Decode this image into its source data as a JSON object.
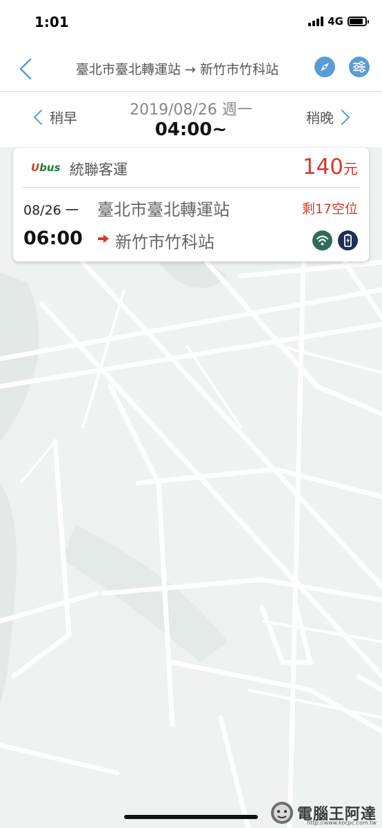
{
  "status_bar": {
    "time": "1:01",
    "network": "4G"
  },
  "header": {
    "title": "臺北市臺北轉運站 → 新竹市竹科站"
  },
  "date_nav": {
    "earlier_label": "稍早",
    "later_label": "稍晚",
    "date": "2019/08/26 週一",
    "time": "04:00~"
  },
  "trip": {
    "logo_prefix": "U",
    "logo_rest": "bus",
    "company": "統聯客運",
    "price": "140",
    "price_unit": "元",
    "date": "08/26 一",
    "from": "臺北市臺北轉運站",
    "seats": "剩17空位",
    "departure_time": "06:00",
    "to": "新竹市竹科站",
    "amenities": [
      "wifi-icon",
      "charging-icon"
    ]
  },
  "watermark": {
    "text": "電腦王阿達",
    "url": "http://www.kocpc.com.tw"
  },
  "colors": {
    "accent": "#5b9bd5",
    "price": "#d7382c",
    "map_bg": "#edf1ef",
    "road": "#ffffff"
  }
}
